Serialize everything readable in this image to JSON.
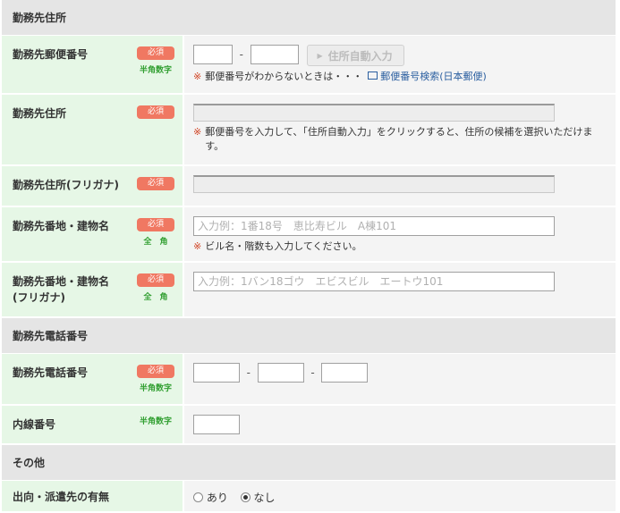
{
  "sections": {
    "work_address": "勤務先住所",
    "work_phone": "勤務先電話番号",
    "other": "その他"
  },
  "badges": {
    "required": "必須",
    "half_digits": "半角数字",
    "full_width": "全　角"
  },
  "postal": {
    "label": "勤務先郵便番号",
    "dash": "-",
    "auto_button": "住所自動入力",
    "note_mark": "※",
    "note": "郵便番号がわからないときは・・・",
    "link": "郵便番号検索(日本郵便)"
  },
  "address": {
    "label": "勤務先住所",
    "note_mark": "※",
    "note": "郵便番号を入力して、「住所自動入力」をクリックすると、住所の候補を選択いただけます。"
  },
  "address_kana": {
    "label": "勤務先住所(フリガナ)"
  },
  "building": {
    "label": "勤務先番地・建物名",
    "placeholder": "入力例：1番18号　恵比寿ビル　A棟101",
    "note_mark": "※",
    "note": "ビル名・階数も入力してください。"
  },
  "building_kana": {
    "label_line1": "勤務先番地・建物名",
    "label_line2": "(フリガナ)",
    "placeholder": "入力例：1バン18ゴウ　エビスビル　エートウ101"
  },
  "phone": {
    "label": "勤務先電話番号",
    "dash": "-"
  },
  "extension": {
    "label": "内線番号"
  },
  "dispatch": {
    "label": "出向・派遣先の有無",
    "option_yes": "あり",
    "option_no": "なし",
    "selected": "なし"
  }
}
